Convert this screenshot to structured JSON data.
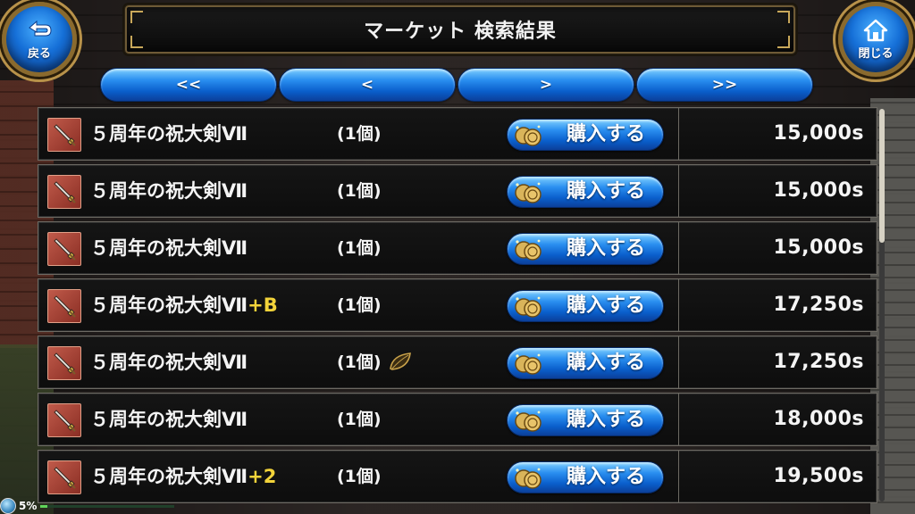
{
  "title": "マーケット 検索結果",
  "back_button": {
    "label": "戻る",
    "icon": "back-arrow-icon"
  },
  "close_button": {
    "label": "閉じる",
    "icon": "home-icon"
  },
  "pagination": [
    "<<",
    "<",
    ">",
    ">>"
  ],
  "buy_label": "購入する",
  "items": [
    {
      "name": "５周年の祝大剣Ⅶ",
      "suffix": "",
      "qty": "(1個)",
      "leaf": false,
      "price": "15,000s"
    },
    {
      "name": "５周年の祝大剣Ⅶ",
      "suffix": "",
      "qty": "(1個)",
      "leaf": false,
      "price": "15,000s"
    },
    {
      "name": "５周年の祝大剣Ⅶ",
      "suffix": "",
      "qty": "(1個)",
      "leaf": false,
      "price": "15,000s"
    },
    {
      "name": "５周年の祝大剣Ⅶ",
      "suffix": "+B",
      "qty": "(1個)",
      "leaf": false,
      "price": "17,250s"
    },
    {
      "name": "５周年の祝大剣Ⅶ",
      "suffix": "",
      "qty": "(1個)",
      "leaf": true,
      "price": "17,250s"
    },
    {
      "name": "５周年の祝大剣Ⅶ",
      "suffix": "",
      "qty": "(1個)",
      "leaf": false,
      "price": "18,000s"
    },
    {
      "name": "５周年の祝大剣Ⅶ",
      "suffix": "+2",
      "qty": "(1個)",
      "leaf": false,
      "price": "19,500s"
    }
  ],
  "status": {
    "percent_label": "5%",
    "percent": 5
  },
  "colors": {
    "accent_blue": "#0a5fcc",
    "frame_gold": "#b8924a",
    "suffix_yellow": "#f2d33a"
  }
}
